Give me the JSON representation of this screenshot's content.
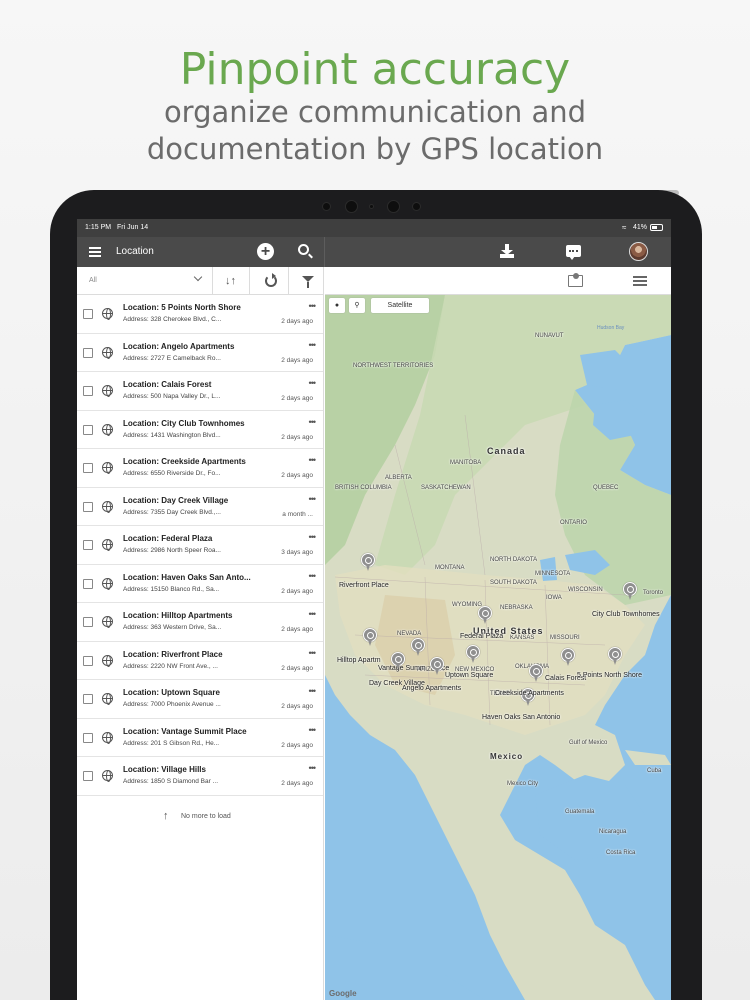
{
  "header": {
    "headline": "Pinpoint accuracy",
    "subline1": "organize communication and",
    "subline2": "documentation by GPS location",
    "accent_color": "#6aa84f"
  },
  "status_bar": {
    "time": "1:15 PM",
    "date": "Fri Jun 14",
    "battery": "41%"
  },
  "toolbar": {
    "title": "Location",
    "icons": [
      "menu-icon",
      "add-icon",
      "search-icon",
      "download-icon",
      "chat-icon",
      "avatar"
    ]
  },
  "filter_bar": {
    "selected": "All",
    "icons": [
      "sort-icon",
      "refresh-icon",
      "funnel-icon"
    ]
  },
  "map_topbar": {
    "icons": [
      "map-pin-icon",
      "list-view-icon"
    ]
  },
  "locations": [
    {
      "title": "Location: 5 Points North Shore",
      "address": "Address: 328 Cherokee Blvd., C...",
      "ago": "2 days ago"
    },
    {
      "title": "Location: Angelo Apartments",
      "address": "Address: 2727 E Camelback Ro...",
      "ago": "2 days ago"
    },
    {
      "title": "Location: Calais Forest",
      "address": "Address: 500 Napa Valley Dr., L...",
      "ago": "2 days ago"
    },
    {
      "title": "Location: City Club Townhomes",
      "address": "Address: 1431 Washington Blvd...",
      "ago": "2 days ago"
    },
    {
      "title": "Location: Creekside Apartments",
      "address": "Address: 6550 Riverside Dr., Fo...",
      "ago": "2 days ago"
    },
    {
      "title": "Location: Day Creek Village",
      "address": "Address: 7355 Day Creek Blvd.,...",
      "ago": "a month ..."
    },
    {
      "title": "Location: Federal Plaza",
      "address": "Address: 2986 North Speer Roa...",
      "ago": "3 days ago"
    },
    {
      "title": "Location: Haven Oaks San Anto...",
      "address": "Address: 15150 Blanco Rd., Sa...",
      "ago": "2 days ago"
    },
    {
      "title": "Location: Hilltop Apartments",
      "address": "Address: 363 Western Drive, Sa...",
      "ago": "2 days ago"
    },
    {
      "title": "Location: Riverfront Place",
      "address": "Address: 2220 NW Front Ave., ...",
      "ago": "2 days ago"
    },
    {
      "title": "Location: Uptown Square",
      "address": "Address: 7000 Phoenix Avenue ...",
      "ago": "2 days ago"
    },
    {
      "title": "Location: Vantage Summit Place",
      "address": "Address: 201 S Gibson Rd., He...",
      "ago": "2 days ago"
    },
    {
      "title": "Location: Village Hills",
      "address": "Address: 1850 S Diamond Bar ...",
      "ago": "2 days ago"
    }
  ],
  "list_footer": "No more to load",
  "map": {
    "satellite_label": "Satellite",
    "google_label": "Google",
    "countries": [
      "Canada",
      "United States",
      "Mexico"
    ],
    "places": [
      "Hudson Bay",
      "NUNAVUT",
      "MANITOBA",
      "ONTARIO",
      "QUEBEC",
      "ALBERTA",
      "SASKATCHEWAN",
      "BRITISH COLUMBIA",
      "NORTHWEST TERRITORIES",
      "NORTH DAKOTA",
      "SOUTH DAKOTA",
      "MINNESOTA",
      "WISCONSIN",
      "MONTANA",
      "WYOMING",
      "NEBRASKA",
      "NEVADA",
      "ARIZONA",
      "NEW MEXICO",
      "TEXAS",
      "KANSAS",
      "OKLAHOMA",
      "MISSOURI",
      "IOWA",
      "Cuba",
      "Guatemala",
      "Nicaragua",
      "Costa Rica",
      "Gulf of Mexico",
      "Toronto",
      "Mexico City"
    ],
    "pins": [
      "Riverfront Place",
      "City Club Townhomes",
      "Federal Plaza",
      "Hilltop Apartments",
      "Uptown Square",
      "Calais Forest",
      "5 Points North Shore",
      "Creekside Apartments",
      "Haven Oaks San Antonio",
      "Day Creek Village",
      "Vantage Summit Place",
      "Village Hills",
      "Angelo Apartments"
    ],
    "pin_labels": {
      "riverfront": "Riverfront Place",
      "cityclub": "City Club Townhomes",
      "federal": "Federal Plaza",
      "hilltop": "Hilltop Apartm",
      "uptown": "Uptown Square",
      "calais": "Calais Forest",
      "fivepoints": "5 Points North Shore",
      "creekside": "Creekside Apartments",
      "havenoaks": "Haven Oaks San Antonio",
      "daycreek": "Day Creek Village",
      "vantage": "Vantage Summ",
      "angelo": "Angelo Apartments",
      "village_frag": "ace"
    }
  }
}
